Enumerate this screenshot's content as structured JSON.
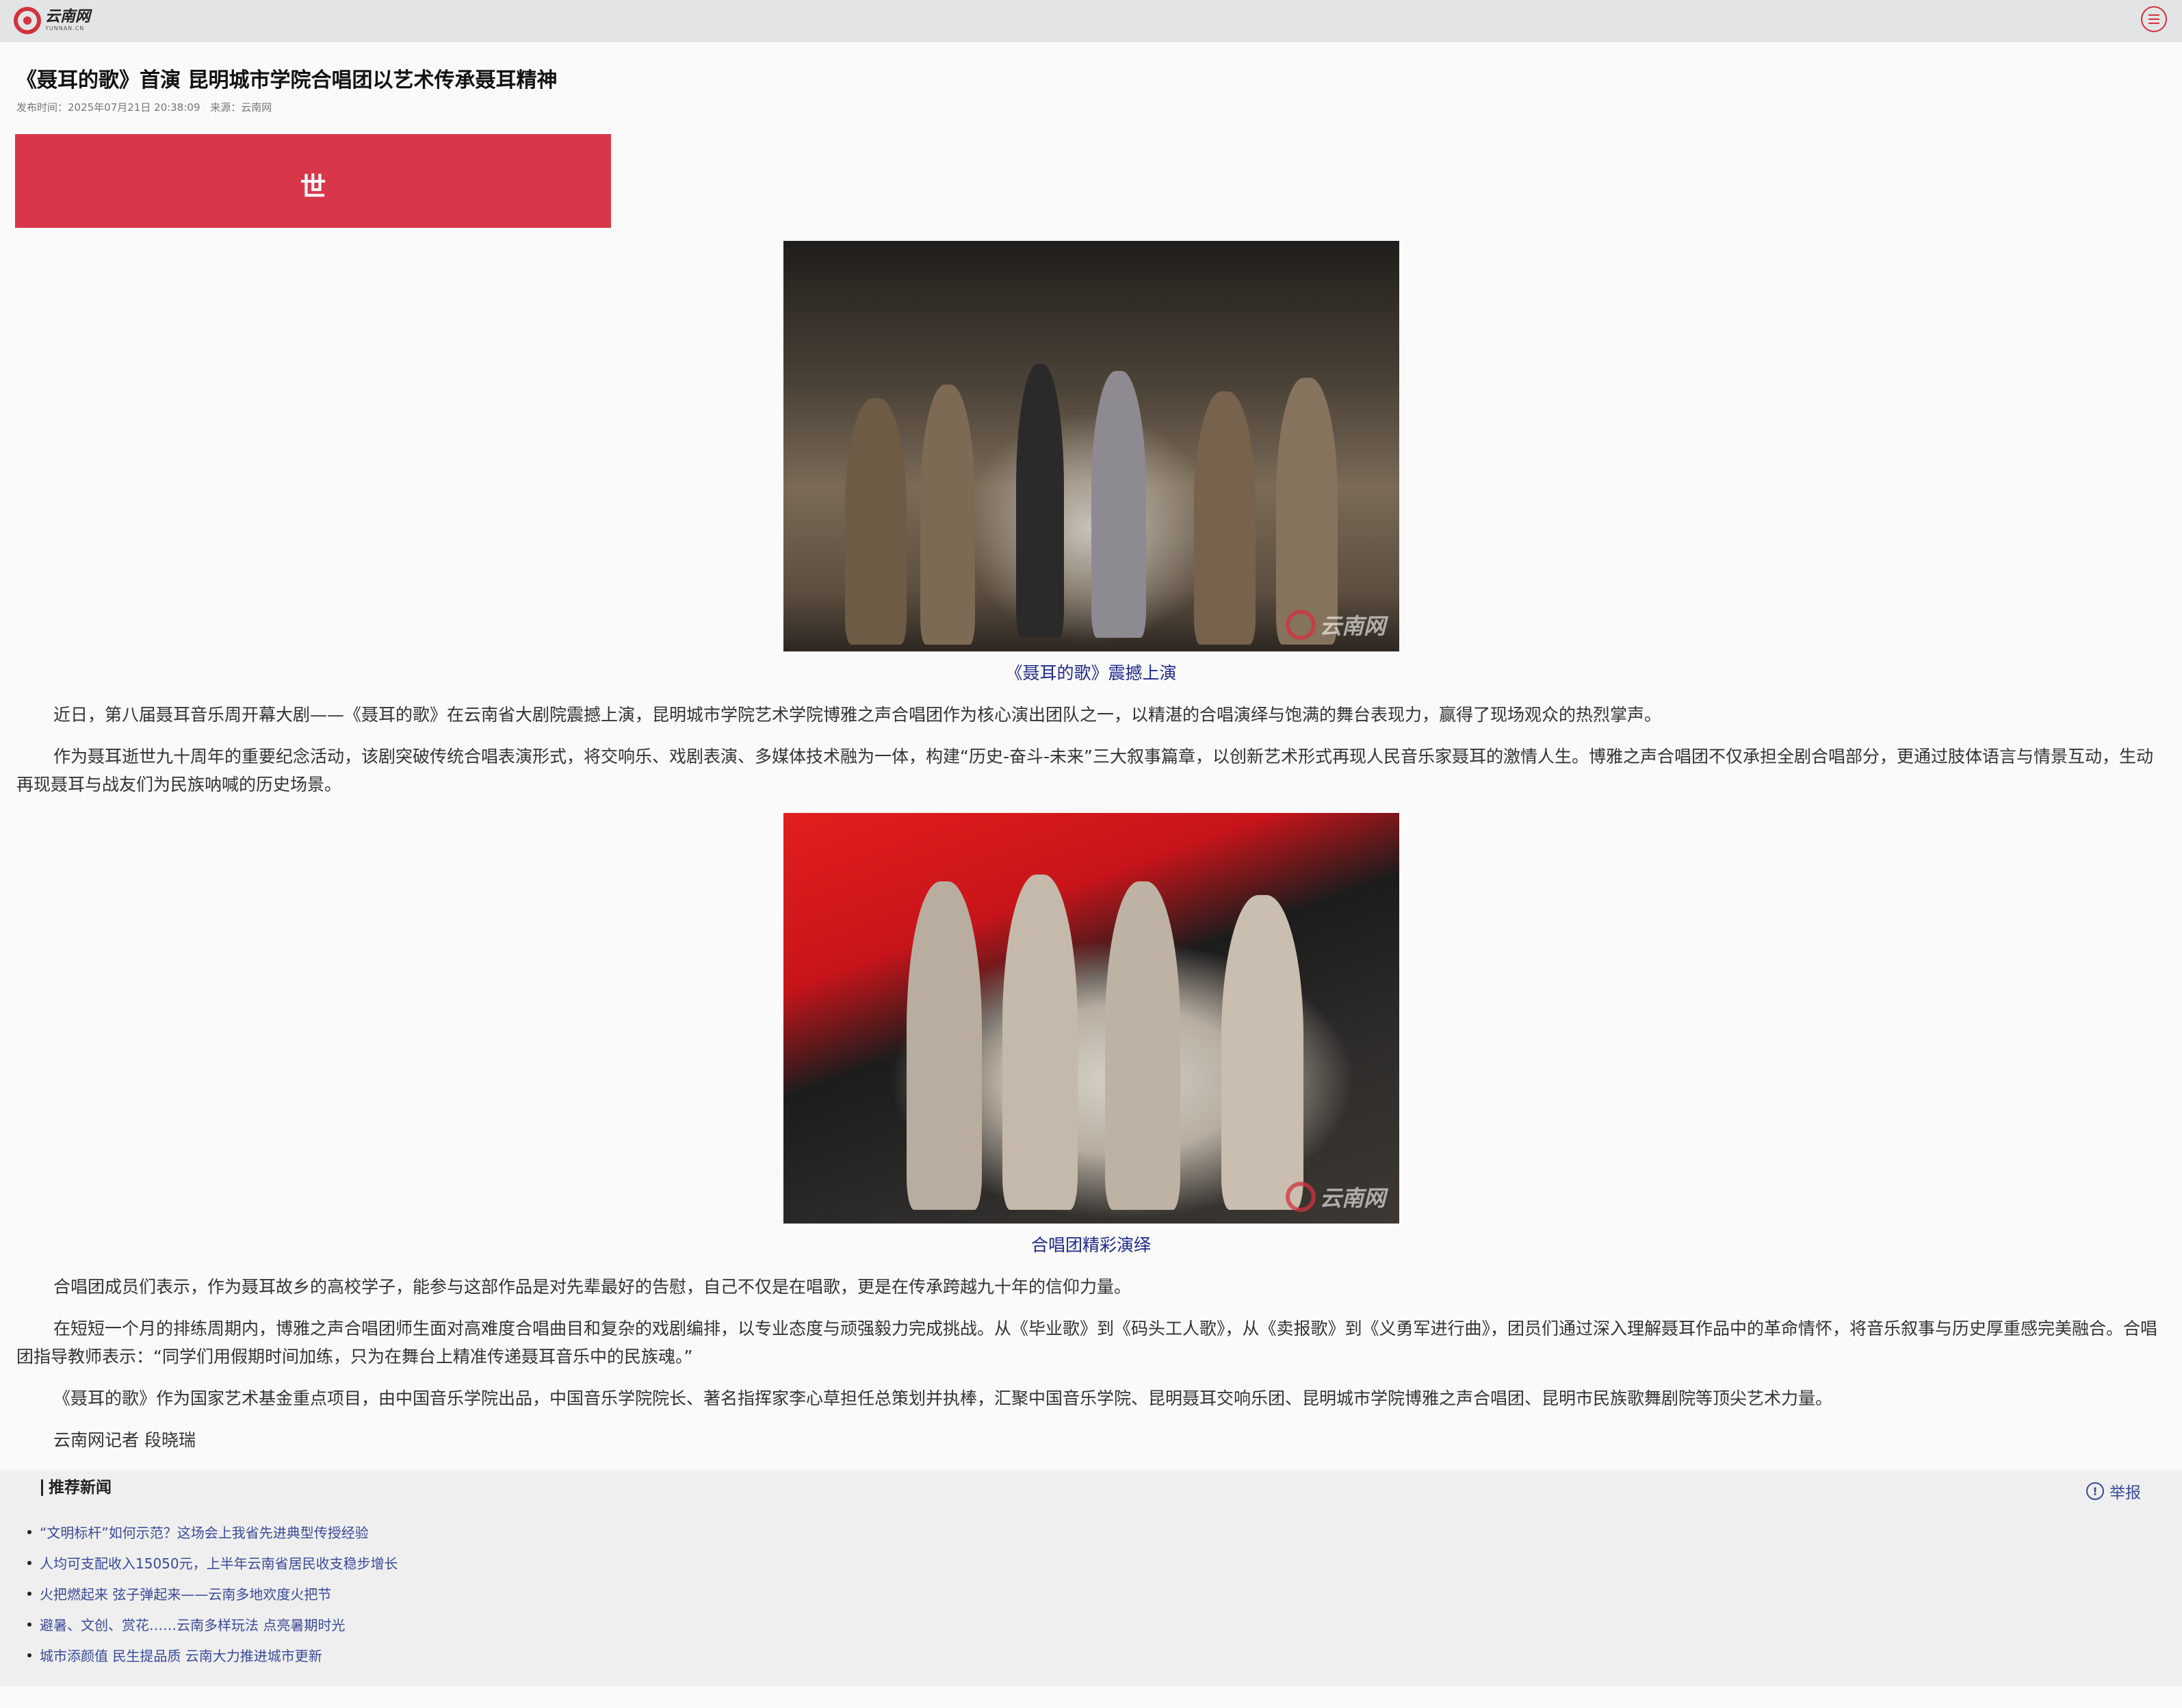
{
  "header": {
    "logo_cn": "云南网",
    "logo_en": "YUNNAN.CN",
    "menu_icon": "menu-icon"
  },
  "article": {
    "title": "《聂耳的歌》首演 昆明城市学院合唱团以艺术传承聂耳精神",
    "publish_time": "发布时间：2025年07月21日 20:38:09",
    "source": "来源：云南网",
    "banner_glyph": "世",
    "image1_caption": "《聂耳的歌》震撼上演",
    "image2_caption": "合唱团精彩演绎",
    "watermark": "云南网",
    "paragraphs_a": [
      "近日，第八届聂耳音乐周开幕大剧——《聂耳的歌》在云南省大剧院震撼上演，昆明城市学院艺术学院博雅之声合唱团作为核心演出团队之一，以精湛的合唱演绎与饱满的舞台表现力，赢得了现场观众的热烈掌声。",
      "作为聂耳逝世九十周年的重要纪念活动，该剧突破传统合唱表演形式，将交响乐、戏剧表演、多媒体技术融为一体，构建“历史-奋斗-未来”三大叙事篇章，以创新艺术形式再现人民音乐家聂耳的激情人生。博雅之声合唱团不仅承担全剧合唱部分，更通过肢体语言与情景互动，生动再现聂耳与战友们为民族呐喊的历史场景。"
    ],
    "paragraphs_b": [
      "合唱团成员们表示，作为聂耳故乡的高校学子，能参与这部作品是对先辈最好的告慰，自己不仅是在唱歌，更是在传承跨越九十年的信仰力量。",
      "在短短一个月的排练周期内，博雅之声合唱团师生面对高难度合唱曲目和复杂的戏剧编排，以专业态度与顽强毅力完成挑战。从《毕业歌》到《码头工人歌》，从《卖报歌》到《义勇军进行曲》，团员们通过深入理解聂耳作品中的革命情怀，将音乐叙事与历史厚重感完美融合。合唱团指导教师表示：“同学们用假期时间加练，只为在舞台上精准传递聂耳音乐中的民族魂。”",
      "《聂耳的歌》作为国家艺术基金重点项目，由中国音乐学院出品，中国音乐学院院长、著名指挥家李心草担任总策划并执棒，汇聚中国音乐学院、昆明聂耳交响乐团、昆明城市学院博雅之声合唱团、昆明市民族歌舞剧院等顶尖艺术力量。",
      "云南网记者 段晓瑞"
    ]
  },
  "recommend": {
    "title": "推荐新闻",
    "report_label": "举报",
    "items": [
      "“文明标杆”如何示范？这场会上我省先进典型传授经验",
      "人均可支配收入15050元，上半年云南省居民收支稳步增长",
      "火把燃起来 弦子弹起来——云南多地欢度火把节",
      "避暑、文创、赏花……云南多样玩法 点亮暑期时光",
      "城市添颜值 民生提品质 云南大力推进城市更新"
    ]
  },
  "colors": {
    "brand_red": "#d2323f",
    "banner_red": "#d8374a",
    "caption_blue": "#1f2a8a",
    "link_blue": "#3a4a9a"
  }
}
